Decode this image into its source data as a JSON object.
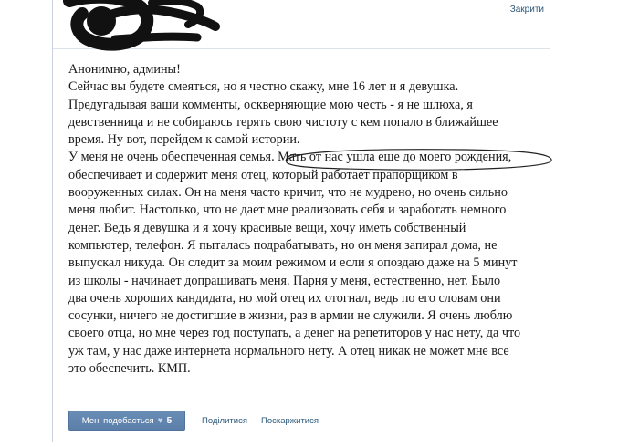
{
  "header": {
    "close_label": "Закрити"
  },
  "post": {
    "lines": [
      "Анонимно, админы!",
      "Сейчас вы будете смеяться, но я честно скажу, мне 16 лет и я девушка.",
      "Предугадывая ваши комменты, оскверняющие мою честь - я не шлюха, я",
      "девственница и не собираюсь терять свою чистоту с кем попало в ближайшее",
      "время. Ну вот, перейдем к самой истории.",
      "У меня не очень обеспеченная семья. Мать от нас ушла еще до моего рождения,",
      "обеспечивает и содержит меня отец, который работает прапорщиком в",
      "вооруженных силах. Он на меня часто кричит, что не мудрено, но очень сильно",
      "меня любит. Настолько, что не дает мне реализовать себя и заработать немного",
      "денег. Ведь я девушка и я хочу красивые вещи, хочу иметь собственный",
      "компьютер, телефон. Я пыталась подрабатывать, но он меня запирал дома, не",
      "выпускал никуда. Он следит за моим режимом и если я опоздаю даже на 5 минут",
      "из школы - начинает допрашивать меня. Парня у меня, естественно, нет. Было",
      "два очень хороших кандидата, но мой отец их отогнал, ведь по его словам они",
      "сосунки, ничего не достигшие в жизни, раз в армии не служили. Я очень люблю",
      "своего отца, но мне через год поступать, а денег на репетиторов у нас нету, да что",
      "уж там, у нас даже интернета нормального нету. А отец никак не может мне все",
      "это обеспечить. КМП."
    ]
  },
  "actions": {
    "like_label": "Мені подобається",
    "like_count": "5",
    "share_label": "Поділитися",
    "report_label": "Поскаржитися"
  },
  "colors": {
    "link": "#2b587a",
    "like_button": "#5b7fa9",
    "text": "#1a1a1a"
  },
  "icons": {
    "like": "heart-icon",
    "redaction": "black-scribble-redaction"
  }
}
